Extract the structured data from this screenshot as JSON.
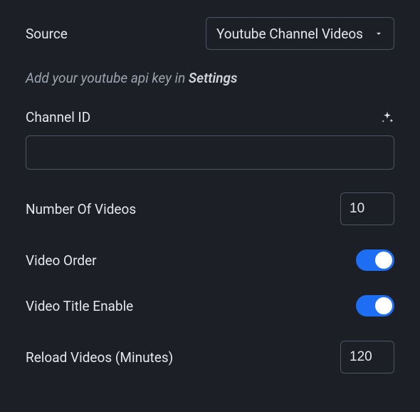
{
  "source": {
    "label": "Source",
    "selected": "Youtube Channel Videos"
  },
  "hint": {
    "prefix": "Add your youtube api key in ",
    "link_label": "Settings"
  },
  "channel_id": {
    "label": "Channel ID",
    "value": ""
  },
  "num_videos": {
    "label": "Number Of Videos",
    "value": "10"
  },
  "video_order": {
    "label": "Video Order",
    "on": true
  },
  "video_title": {
    "label": "Video Title Enable",
    "on": true
  },
  "reload": {
    "label": "Reload Videos (Minutes)",
    "value": "120"
  }
}
